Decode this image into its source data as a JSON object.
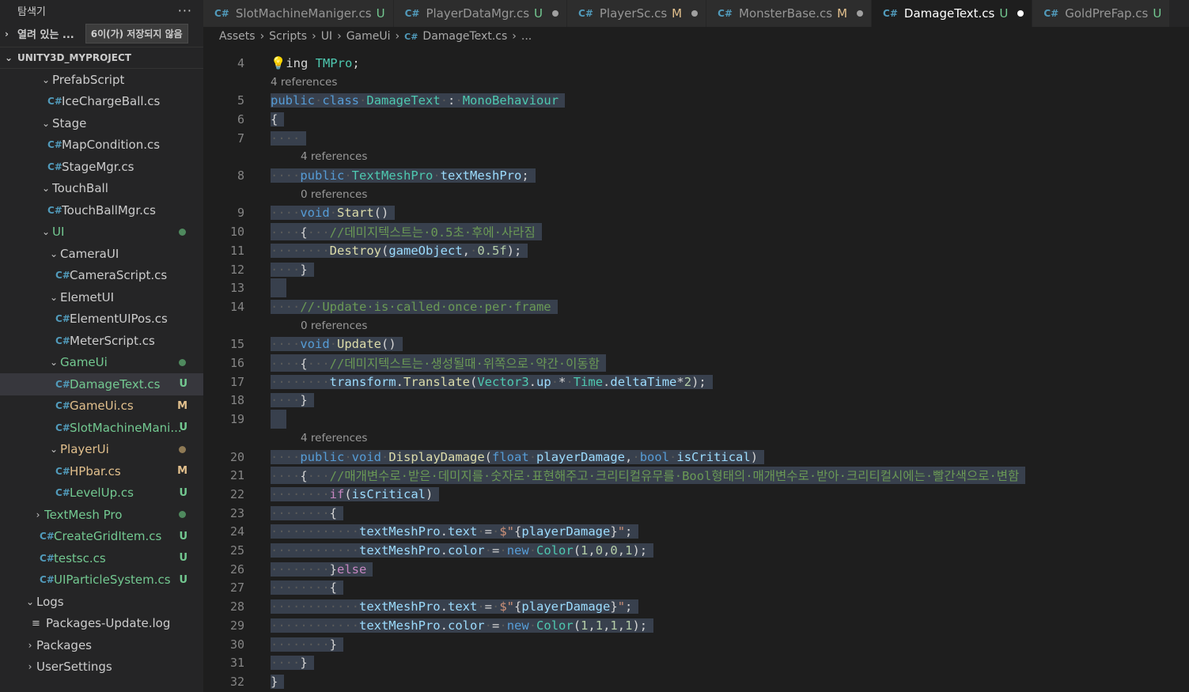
{
  "sidebar": {
    "title": "탐색기",
    "more": "···",
    "open_editors": "열려 있는 ...",
    "unsaved": "6이(가) 저장되지 않음",
    "project": "UNITY3D_MYPROJECT",
    "tree": [
      {
        "label": "PrefabScript",
        "kind": "folder",
        "indent": 1
      },
      {
        "label": "IceChargeBall.cs",
        "kind": "cs",
        "indent": 1
      },
      {
        "label": "Stage",
        "kind": "folder",
        "indent": 1
      },
      {
        "label": "MapCondition.cs",
        "kind": "cs",
        "indent": 1
      },
      {
        "label": "StageMgr.cs",
        "kind": "cs",
        "indent": 1
      },
      {
        "label": "TouchBall",
        "kind": "folder",
        "indent": 1
      },
      {
        "label": "TouchBallMgr.cs",
        "kind": "cs",
        "indent": 1
      },
      {
        "label": "UI",
        "kind": "folder",
        "indent": 1,
        "color": "green",
        "dot": "green"
      },
      {
        "label": "CameraUI",
        "kind": "folder",
        "indent": 2
      },
      {
        "label": "CameraScript.cs",
        "kind": "cs",
        "indent": 2
      },
      {
        "label": "ElemetUI",
        "kind": "folder",
        "indent": 2
      },
      {
        "label": "ElementUIPos.cs",
        "kind": "cs",
        "indent": 2
      },
      {
        "label": "MeterScript.cs",
        "kind": "cs",
        "indent": 2
      },
      {
        "label": "GameUi",
        "kind": "folder",
        "indent": 2,
        "color": "green",
        "dot": "green"
      },
      {
        "label": "DamageText.cs",
        "kind": "cs",
        "indent": 2,
        "color": "green",
        "badge": "U",
        "selected": true
      },
      {
        "label": "GameUi.cs",
        "kind": "cs",
        "indent": 2,
        "color": "mod",
        "badge": "M"
      },
      {
        "label": "SlotMachineMani...",
        "kind": "cs",
        "indent": 2,
        "color": "green",
        "badge": "U"
      },
      {
        "label": "PlayerUi",
        "kind": "folder",
        "indent": 2,
        "color": "mod",
        "dot": "mod"
      },
      {
        "label": "HPbar.cs",
        "kind": "cs",
        "indent": 2,
        "color": "mod",
        "badge": "M"
      },
      {
        "label": "LevelUp.cs",
        "kind": "cs",
        "indent": 2,
        "color": "green",
        "badge": "U"
      },
      {
        "label": "TextMesh Pro",
        "kind": "folder-closed",
        "indent": 0,
        "color": "green",
        "dot": "green"
      },
      {
        "label": "CreateGridItem.cs",
        "kind": "cs",
        "indent": 0,
        "color": "green",
        "badge": "U"
      },
      {
        "label": "testsc.cs",
        "kind": "cs",
        "indent": 0,
        "color": "green",
        "badge": "U"
      },
      {
        "label": "UIParticleSystem.cs",
        "kind": "cs",
        "indent": 0,
        "color": "green",
        "badge": "U"
      },
      {
        "label": "Logs",
        "kind": "folder",
        "indent": -1
      },
      {
        "label": "Packages-Update.log",
        "kind": "log",
        "indent": -1
      },
      {
        "label": "Packages",
        "kind": "folder-closed",
        "indent": -1
      },
      {
        "label": "UserSettings",
        "kind": "folder-closed",
        "indent": -1
      }
    ]
  },
  "tabs": [
    {
      "label": "SlotMachineManiger.cs",
      "status": "U"
    },
    {
      "label": "PlayerDataMgr.cs",
      "status": "U",
      "dot": true
    },
    {
      "label": "PlayerSc.cs",
      "status": "M",
      "dot": true
    },
    {
      "label": "MonsterBase.cs",
      "status": "M",
      "dot": true
    },
    {
      "label": "DamageText.cs",
      "status": "U",
      "dot": true,
      "active": true
    },
    {
      "label": "GoldPreFap.cs",
      "status": "U"
    }
  ],
  "icons": {
    "cs": "C#",
    "chev_open": "⌄",
    "chev_closed": "›",
    "log": "≡",
    "bulb": "💡"
  },
  "breadcrumb": [
    "Assets",
    "Scripts",
    "UI",
    "GameUi",
    "DamageText.cs",
    "..."
  ],
  "editor": {
    "lines": [
      {
        "n": "4",
        "html": "<span class=\"bulb\">💡</span>ing <span class=\"ty\">TMPro</span>;",
        "plain": true
      },
      {
        "lens": "4 references",
        "lensIndent": 0
      },
      {
        "n": "5",
        "html": "<span class=\"kw\">public</span><span class=\"ws\">·</span><span class=\"kw\">class</span><span class=\"ws\">·</span><span class=\"ty\">DamageText</span><span class=\"ws\">·</span>:<span class=\"ws\">·</span><span class=\"ty\">MonoBehaviour</span>"
      },
      {
        "n": "6",
        "html": "{"
      },
      {
        "n": "7",
        "html": "<span class=\"ws\">····</span>"
      },
      {
        "lens": "4 references",
        "lensIndent": 1
      },
      {
        "n": "8",
        "html": "<span class=\"ws\">····</span><span class=\"kw\">public</span><span class=\"ws\">·</span><span class=\"ty\">TextMeshPro</span><span class=\"ws\">·</span><span class=\"var\">textMeshPro</span>;"
      },
      {
        "lens": "0 references",
        "lensIndent": 1
      },
      {
        "n": "9",
        "html": "<span class=\"ws\">····</span><span class=\"kw\">void</span><span class=\"ws\">·</span><span class=\"fn\">Start</span>()"
      },
      {
        "n": "10",
        "html": "<span class=\"ws\">····</span>{<span class=\"ws\">···</span><span class=\"cm\">//데미지텍스트는·0.5초·후에·사라짐</span>"
      },
      {
        "n": "11",
        "html": "<span class=\"ws\">········</span><span class=\"fn\">Destroy</span>(<span class=\"var\">gameObject</span>,<span class=\"ws\">·</span><span class=\"num\">0.5f</span>);"
      },
      {
        "n": "12",
        "html": "<span class=\"ws\">····</span>}"
      },
      {
        "n": "13",
        "html": "",
        "empty": true
      },
      {
        "n": "14",
        "html": "<span class=\"ws\">····</span><span class=\"cm\">//·Update·is·called·once·per·frame</span>"
      },
      {
        "lens": "0 references",
        "lensIndent": 1
      },
      {
        "n": "15",
        "html": "<span class=\"ws\">····</span><span class=\"kw\">void</span><span class=\"ws\">·</span><span class=\"fn\">Update</span>()"
      },
      {
        "n": "16",
        "html": "<span class=\"ws\">····</span>{<span class=\"ws\">···</span><span class=\"cm\">//데미지텍스트는·생성될때·위쪽으로·약간·이동함</span>"
      },
      {
        "n": "17",
        "html": "<span class=\"ws\">········</span><span class=\"var\">transform</span>.<span class=\"fn\">Translate</span>(<span class=\"ty\">Vector3</span>.<span class=\"var\">up</span><span class=\"ws\">·</span>*<span class=\"ws\">·</span><span class=\"ty\">Time</span>.<span class=\"var\">deltaTime</span>*<span class=\"num\">2</span>);"
      },
      {
        "n": "18",
        "html": "<span class=\"ws\">····</span>}"
      },
      {
        "n": "19",
        "html": "",
        "empty": true
      },
      {
        "lens": "4 references",
        "lensIndent": 1
      },
      {
        "n": "20",
        "html": "<span class=\"ws\">····</span><span class=\"kw\">public</span><span class=\"ws\">·</span><span class=\"kw\">void</span><span class=\"ws\">·</span><span class=\"fn\">DisplayDamage</span>(<span class=\"kw\">float</span><span class=\"ws\">·</span><span class=\"var\">playerDamage</span>,<span class=\"ws\">·</span><span class=\"kw\">bool</span><span class=\"ws\">·</span><span class=\"var\">isCritical</span>)"
      },
      {
        "n": "21",
        "html": "<span class=\"ws\">····</span>{<span class=\"ws\">···</span><span class=\"cm\">//매개변수로·받은·데미지를·숫자로·표현해주고·크리티컬유무를·Bool형태의·매개변수로·받아·크리티컬시에는·빨간색으로·변함</span>"
      },
      {
        "n": "22",
        "html": "<span class=\"ws\">········</span><span class=\"ctl\">if</span>(<span class=\"var\">isCritical</span>)"
      },
      {
        "n": "23",
        "html": "<span class=\"ws\">········</span>{"
      },
      {
        "n": "24",
        "html": "<span class=\"ws\">············</span><span class=\"var\">textMeshPro</span>.<span class=\"var\">text</span><span class=\"ws\">·</span>=<span class=\"ws\">·</span><span class=\"str\">$\"</span>{<span class=\"var\">playerDamage</span>}<span class=\"str\">\"</span>;"
      },
      {
        "n": "25",
        "html": "<span class=\"ws\">············</span><span class=\"var\">textMeshPro</span>.<span class=\"var\">color</span><span class=\"ws\">·</span>=<span class=\"ws\">·</span><span class=\"kw\">new</span><span class=\"ws\">·</span><span class=\"ty\">Color</span>(<span class=\"num\">1</span>,<span class=\"num\">0</span>,<span class=\"num\">0</span>,<span class=\"num\">1</span>);"
      },
      {
        "n": "26",
        "html": "<span class=\"ws\">········</span>}<span class=\"ctl\">else</span>"
      },
      {
        "n": "27",
        "html": "<span class=\"ws\">········</span>{"
      },
      {
        "n": "28",
        "html": "<span class=\"ws\">············</span><span class=\"var\">textMeshPro</span>.<span class=\"var\">text</span><span class=\"ws\">·</span>=<span class=\"ws\">·</span><span class=\"str\">$\"</span>{<span class=\"var\">playerDamage</span>}<span class=\"str\">\"</span>;"
      },
      {
        "n": "29",
        "html": "<span class=\"ws\">············</span><span class=\"var\">textMeshPro</span>.<span class=\"var\">color</span><span class=\"ws\">·</span>=<span class=\"ws\">·</span><span class=\"kw\">new</span><span class=\"ws\">·</span><span class=\"ty\">Color</span>(<span class=\"num\">1</span>,<span class=\"num\">1</span>,<span class=\"num\">1</span>,<span class=\"num\">1</span>);"
      },
      {
        "n": "30",
        "html": "<span class=\"ws\">········</span>}"
      },
      {
        "n": "31",
        "html": "<span class=\"ws\">····</span>}"
      },
      {
        "n": "32",
        "html": "}"
      }
    ]
  }
}
